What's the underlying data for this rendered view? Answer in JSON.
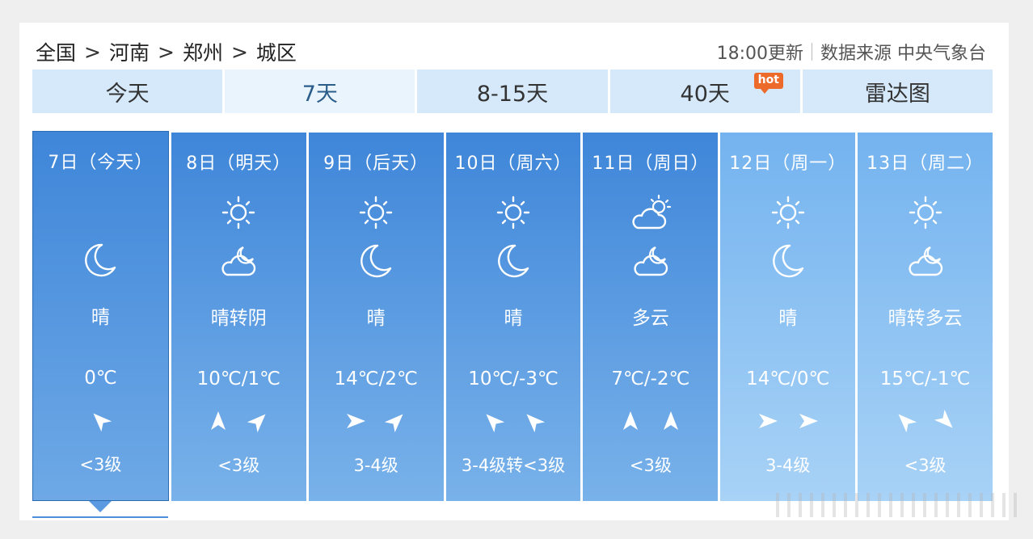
{
  "breadcrumb": {
    "items": [
      "全国",
      "河南",
      "郑州",
      "城区"
    ],
    "separator": ">"
  },
  "meta": {
    "update": "18:00更新",
    "source": "数据来源 中央气象台"
  },
  "tabs": [
    {
      "label": "今天"
    },
    {
      "label": "7天"
    },
    {
      "label": "8-15天"
    },
    {
      "label": "40天",
      "badge": "hot"
    },
    {
      "label": "雷达图"
    }
  ],
  "colors": {
    "tile": "#3f86d9",
    "tile_future": "#74b3ef",
    "tab": "#d6e9fa",
    "hot": "#ec6a2a"
  },
  "days": [
    {
      "date": "7日（今天）",
      "icon_day": "moon-icon",
      "icon_night": "",
      "weather": "晴",
      "temp": "0℃",
      "wind": [
        "northwest"
      ],
      "level": "<3级"
    },
    {
      "date": "8日（明天）",
      "icon_day": "sun-icon",
      "icon_night": "cloud-moon-icon",
      "weather": "晴转阴",
      "temp": "10℃/1℃",
      "wind": [
        "north",
        "northeast"
      ],
      "level": "<3级"
    },
    {
      "date": "9日（后天）",
      "icon_day": "sun-icon",
      "icon_night": "moon-icon",
      "weather": "晴",
      "temp": "14℃/2℃",
      "wind": [
        "east",
        "northeast"
      ],
      "level": "3-4级"
    },
    {
      "date": "10日（周六）",
      "icon_day": "sun-icon",
      "icon_night": "moon-icon",
      "weather": "晴",
      "temp": "10℃/-3℃",
      "wind": [
        "northwest",
        "northwest"
      ],
      "level": "3-4级转<3级"
    },
    {
      "date": "11日（周日）",
      "icon_day": "cloud-sun-icon",
      "icon_night": "cloud-moon-icon",
      "weather": "多云",
      "temp": "7℃/-2℃",
      "wind": [
        "north",
        "north"
      ],
      "level": "<3级"
    },
    {
      "date": "12日（周一）",
      "icon_day": "sun-icon",
      "icon_night": "moon-icon",
      "weather": "晴",
      "temp": "14℃/0℃",
      "wind": [
        "east",
        "east"
      ],
      "level": "3-4级"
    },
    {
      "date": "13日（周二）",
      "icon_day": "sun-icon",
      "icon_night": "cloud-moon-icon",
      "weather": "晴转多云",
      "temp": "15℃/-1℃",
      "wind": [
        "northwest",
        "southeast"
      ],
      "level": "<3级"
    }
  ]
}
